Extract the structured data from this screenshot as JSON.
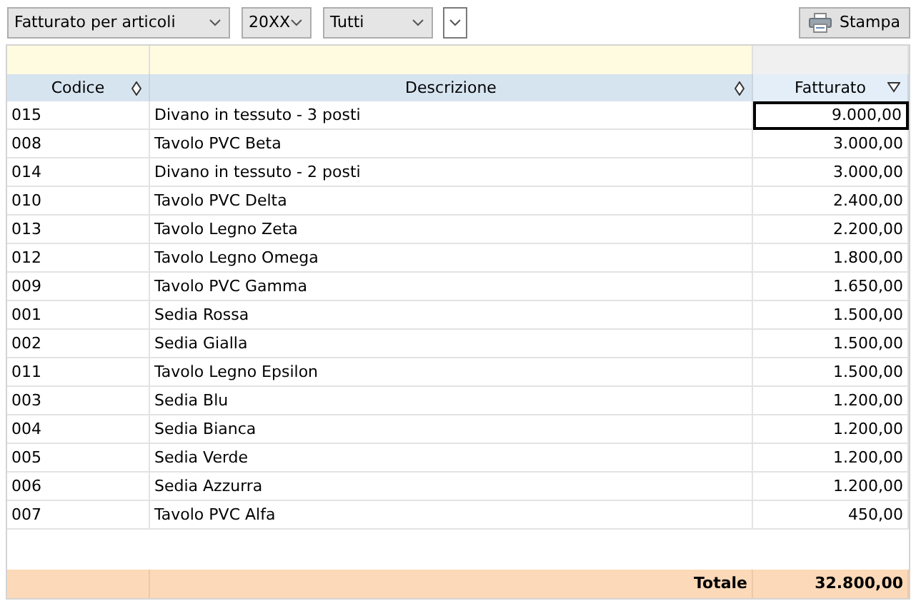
{
  "toolbar": {
    "dropdowns": [
      {
        "kind": "combo",
        "value": "Fatturato per articoli"
      },
      {
        "kind": "combo",
        "value": "20XX"
      },
      {
        "kind": "combo",
        "value": "Tutti"
      },
      {
        "kind": "arrow"
      }
    ],
    "print_button": {
      "label": "Stampa"
    }
  },
  "table": {
    "columns": [
      {
        "label": "Codice",
        "sorted": false,
        "filterable": true
      },
      {
        "label": "Descrizione",
        "sorted": false,
        "filterable": true
      },
      {
        "label": "Fatturato",
        "sorted": true,
        "filterable": false
      }
    ],
    "rows": [
      {
        "code": "015",
        "description": "Divano in tessuto - 3 posti",
        "amount": "9.000,00",
        "focused": true
      },
      {
        "code": "008",
        "description": "Tavolo PVC Beta",
        "amount": "3.000,00",
        "focused": false
      },
      {
        "code": "014",
        "description": "Divano in tessuto - 2 posti",
        "amount": "3.000,00",
        "focused": false
      },
      {
        "code": "010",
        "description": "Tavolo PVC Delta",
        "amount": "2.400,00",
        "focused": false
      },
      {
        "code": "013",
        "description": "Tavolo Legno Zeta",
        "amount": "2.200,00",
        "focused": false
      },
      {
        "code": "012",
        "description": "Tavolo Legno Omega",
        "amount": "1.800,00",
        "focused": false
      },
      {
        "code": "009",
        "description": "Tavolo PVC Gamma",
        "amount": "1.650,00",
        "focused": false
      },
      {
        "code": "001",
        "description": "Sedia Rossa",
        "amount": "1.500,00",
        "focused": false
      },
      {
        "code": "002",
        "description": "Sedia Gialla",
        "amount": "1.500,00",
        "focused": false
      },
      {
        "code": "011",
        "description": "Tavolo Legno Epsilon",
        "amount": "1.500,00",
        "focused": false
      },
      {
        "code": "003",
        "description": "Sedia Blu",
        "amount": "1.200,00",
        "focused": false
      },
      {
        "code": "004",
        "description": "Sedia Bianca",
        "amount": "1.200,00",
        "focused": false
      },
      {
        "code": "005",
        "description": "Sedia Verde",
        "amount": "1.200,00",
        "focused": false
      },
      {
        "code": "006",
        "description": "Sedia Azzurra",
        "amount": "1.200,00",
        "focused": false
      },
      {
        "code": "007",
        "description": "Tavolo PVC Alfa",
        "amount": "450,00",
        "focused": false
      }
    ],
    "total": {
      "label": "Totale",
      "value": "32.800,00"
    }
  }
}
